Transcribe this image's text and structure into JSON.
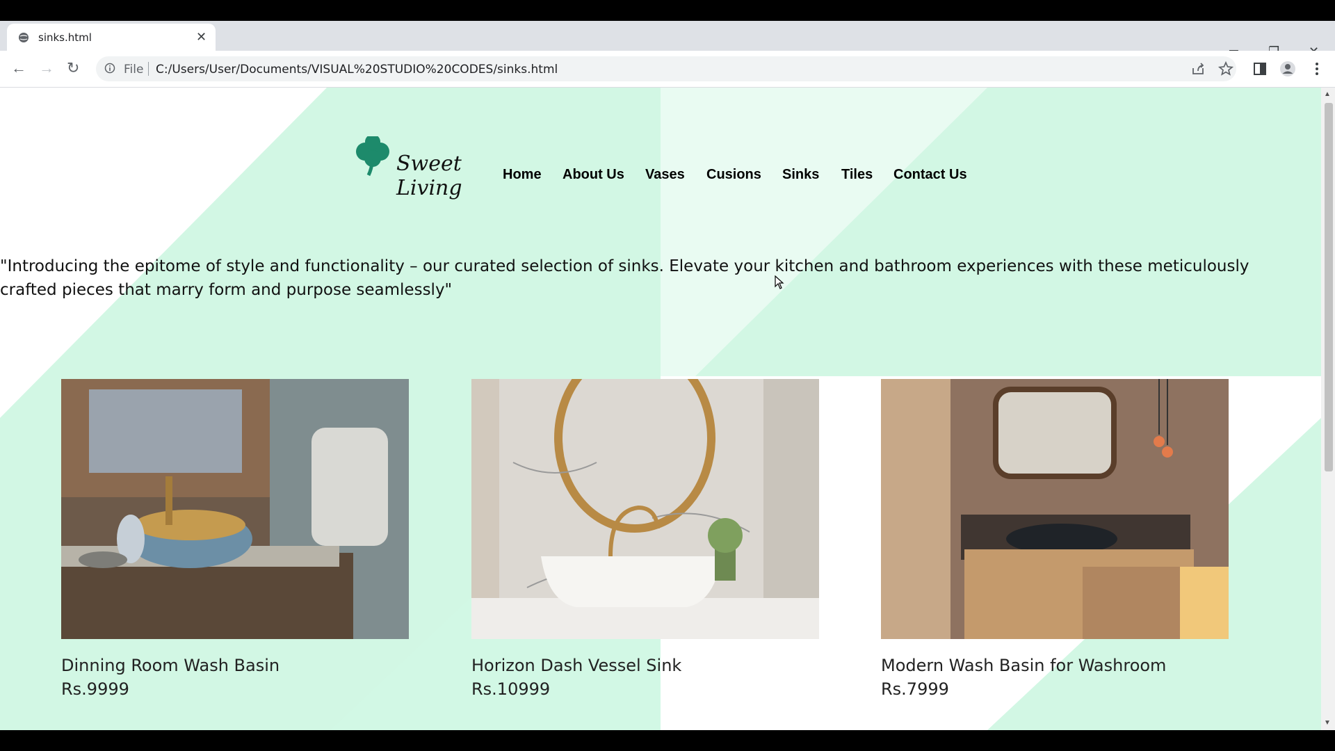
{
  "browser": {
    "tab_title": "sinks.html",
    "address_scheme": "File",
    "address_url": "C:/Users/User/Documents/VISUAL%20STUDIO%20CODES/sinks.html"
  },
  "site": {
    "brand": "Sweet Living",
    "nav": [
      "Home",
      "About Us",
      "Vases",
      "Cusions",
      "Sinks",
      "Tiles",
      "Contact Us"
    ],
    "intro": "\"Introducing the epitome of style and functionality – our curated selection of sinks. Elevate your kitchen and bathroom experiences with these meticulously crafted pieces that marry form and purpose seamlessly\"",
    "products": [
      {
        "name": "Dinning Room Wash Basin",
        "price": "Rs.9999"
      },
      {
        "name": "Horizon Dash Vessel Sink",
        "price": "Rs.10999"
      },
      {
        "name": "Modern Wash Basin for Washroom",
        "price": "Rs.7999"
      }
    ]
  },
  "colors": {
    "mint": "#d2f7e4",
    "mint_light": "#e9fbf2",
    "logo_green": "#1d8a6b"
  }
}
